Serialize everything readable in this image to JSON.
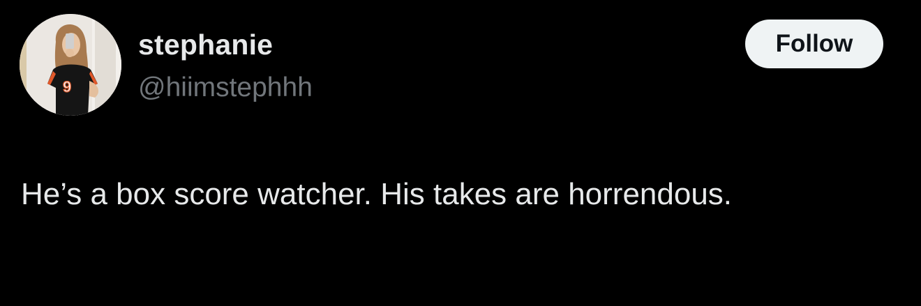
{
  "author": {
    "display_name": "stephanie",
    "handle": "@hiimstephhh",
    "avatar_icon": "profile-photo",
    "avatar_jersey_number": "9"
  },
  "actions": {
    "follow_label": "Follow"
  },
  "tweet": {
    "text": "He’s a box score watcher. His takes are horrendous."
  },
  "colors": {
    "background": "#000000",
    "primary_text": "#e7e9ea",
    "secondary_text": "#71767b",
    "follow_button_bg": "#eff3f4",
    "follow_button_text": "#0f1419"
  }
}
